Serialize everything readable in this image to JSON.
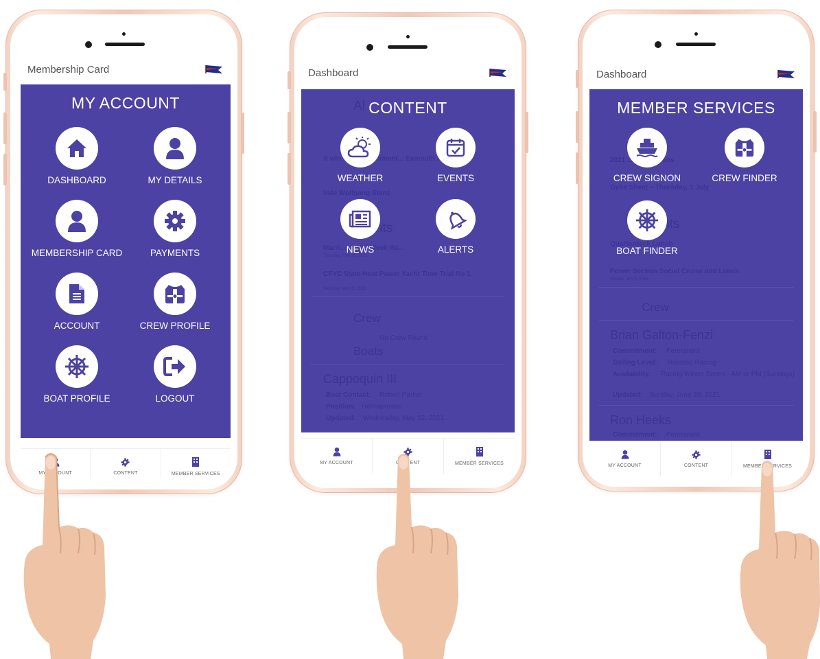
{
  "screens": [
    {
      "header_title": "Membership Card",
      "overlay_title": "MY ACCOUNT",
      "tiles": [
        {
          "label": "DASHBOARD",
          "icon": "home-icon"
        },
        {
          "label": "MY DETAILS",
          "icon": "user-icon"
        },
        {
          "label": "MEMBERSHIP CARD",
          "icon": "user-icon"
        },
        {
          "label": "PAYMENTS",
          "icon": "gear-icon"
        },
        {
          "label": "ACCOUNT",
          "icon": "document-icon"
        },
        {
          "label": "CREW PROFILE",
          "icon": "life-jacket-icon"
        },
        {
          "label": "BOAT PROFILE",
          "icon": "ship-wheel-icon"
        },
        {
          "label": "LOGOUT",
          "icon": "logout-icon"
        }
      ],
      "tabs": [
        "MY ACCOUNT",
        "CONTENT",
        "MEMBER SERVICES"
      ]
    },
    {
      "header_title": "Dashboard",
      "overlay_title": "CONTENT",
      "tiles": [
        {
          "label": "WEATHER",
          "icon": "weather-icon"
        },
        {
          "label": "EVENTS",
          "icon": "calendar-icon"
        },
        {
          "label": "NEWS",
          "icon": "newspaper-icon"
        },
        {
          "label": "ALERTS",
          "icon": "bell-icon"
        }
      ],
      "background": {
        "alerts": "Al",
        "news_items": [
          "A win ... in the Fremant... Exmouth Race",
          "Vale Wolfgang Stenz"
        ],
        "events_heading": "nts",
        "event_items": [
          "Marri... rk Mid Week Ra...",
          "CFYC State Heat Power Yacht Time Trial No 1"
        ],
        "event_dates": [
          "Thursday, May 20, 2021",
          "Saturday, May 22, 2021"
        ],
        "crew_heading": "Crew",
        "crew_empty": "No Crew Found",
        "boats_heading": "Boats",
        "boat_name": "Cappoquin III",
        "boat_contact_label": "Boat Contact:",
        "boat_contact": "Robert Parker",
        "position_label": "Position:",
        "position": "Helmsperson",
        "updated_label": "Updated:",
        "updated": "Wednesday, May 12, 2021"
      },
      "tabs": [
        "MY ACCOUNT",
        "CONTENT",
        "MEMBER SERVICES"
      ]
    },
    {
      "header_title": "Dashboard",
      "overlay_title": "MEMBER SERVICES",
      "tiles": [
        {
          "label": "CREW SIGNON",
          "icon": "ship-icon"
        },
        {
          "label": "CREW FINDER",
          "icon": "life-jacket-icon"
        },
        {
          "label": "BOAT FINDER",
          "icon": "ship-wheel-icon"
        }
      ],
      "background": {
        "news_items": [
          "2021 ... y Donations",
          "Gybe Sheet – Thursday, 1 July"
        ],
        "events_heading": "nts",
        "event_items": [
          "Quarterdeck Lunch",
          "Power Section Social Cruise and Lunch"
        ],
        "event_dates": [
          "Sunday, July 4, 2021"
        ],
        "crew_heading": "Crew",
        "crew1_name": "Brian Galton-Fenzi",
        "commitment_label": "Commitment:",
        "commitment": "Permanent",
        "sailing_label": "Sailing Level:",
        "sailing": "Relaxed Racing",
        "availability_label": "Availability:",
        "availability": "Racing Winter Series - AM or PM (Sundays)",
        "updated_label": "Updated:",
        "updated": "Sunday, June 20, 2021",
        "crew2_name": "Ron Heeks",
        "crew2_commitment": "Permanent"
      },
      "tabs": [
        "MY ACCOUNT",
        "CONTENT",
        "MEMBER SERVICES"
      ]
    }
  ],
  "colors": {
    "overlay": "#4b42a3",
    "tab_icon": "#4b42a3",
    "phone_frame": "#f0c9b6"
  }
}
